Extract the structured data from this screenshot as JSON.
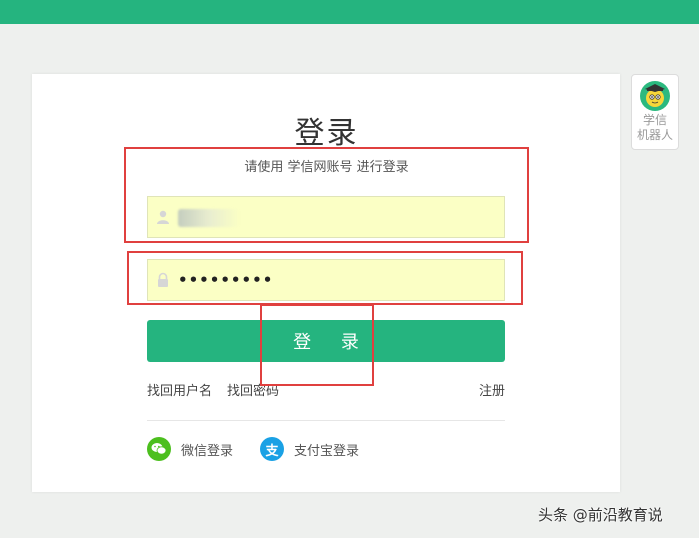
{
  "title": "登录",
  "subtitle": "请使用 学信网账号 进行登录",
  "username": {
    "value": ""
  },
  "password": {
    "masked_value": "•••••••••"
  },
  "login_button": "登 录",
  "links": {
    "find_username": "找回用户名",
    "find_password": "找回密码",
    "register": "注册"
  },
  "third_party": {
    "wechat": "微信登录",
    "alipay": "支付宝登录",
    "alipay_icon_char": "支"
  },
  "robot": {
    "line1": "学信",
    "line2": "机器人"
  },
  "watermark": "头条 @前沿教育说",
  "colors": {
    "brand_green": "#25b47f",
    "field_bg": "#fbffc5",
    "highlight_red": "#e0403f"
  }
}
